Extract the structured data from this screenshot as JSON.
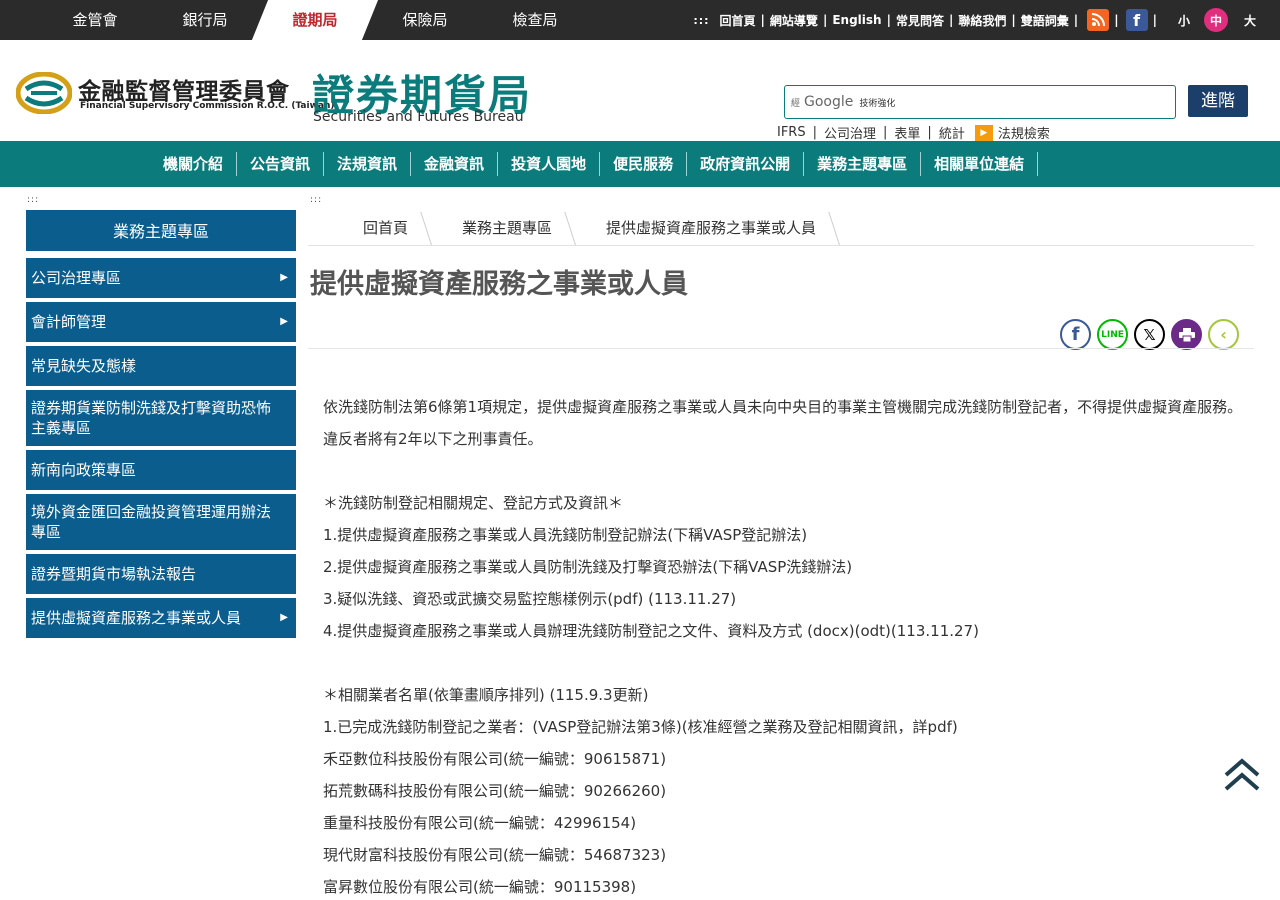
{
  "agency_tabs": [
    {
      "label": "金管會"
    },
    {
      "label": "銀行局"
    },
    {
      "label": "證期局"
    },
    {
      "label": "保險局"
    },
    {
      "label": "檢查局"
    }
  ],
  "util": {
    "dots": ":::",
    "links": [
      "回首頁",
      "網站導覽",
      "English",
      "常見問答",
      "聯絡我們",
      "雙語詞彙"
    ],
    "font_small": "小",
    "font_medium": "中",
    "font_large": "大"
  },
  "header": {
    "fsc_name_zh": "金融監督管理委員會",
    "fsc_name_en": "Financial Supervisory Commission R.O.C. (Taiwan)",
    "bureau_name_zh": "證券期貨局",
    "bureau_name_en": "Securities and Futures Bureau"
  },
  "search": {
    "by": "經",
    "brand": "Google",
    "enhanced": "技術強化",
    "button": "進階"
  },
  "quick_links": [
    "IFRS",
    "公司治理",
    "表單",
    "統計"
  ],
  "law_search": "法規檢索",
  "main_nav": [
    "機關介紹",
    "公告資訊",
    "法規資訊",
    "金融資訊",
    "投資人園地",
    "便民服務",
    "政府資訊公開",
    "業務主題專區",
    "相關單位連結"
  ],
  "sidebar": {
    "dots": ":::",
    "title": "業務主題專區",
    "items": [
      {
        "label": "公司治理專區",
        "caret": "▶"
      },
      {
        "label": "會計師管理",
        "caret": "▶"
      },
      {
        "label": "常見缺失及態樣"
      },
      {
        "label": "證券期貨業防制洗錢及打擊資助恐怖主義專區"
      },
      {
        "label": "新南向政策專區"
      },
      {
        "label": "境外資金匯回金融投資管理運用辦法專區"
      },
      {
        "label": "證券暨期貨市場執法報告"
      },
      {
        "label": "提供虛擬資產服務之事業或人員",
        "caret": "▶"
      }
    ]
  },
  "content": {
    "dots": ":::",
    "breadcrumb": [
      "回首頁",
      "業務主題專區",
      "提供虛擬資產服務之事業或人員"
    ],
    "title": "提供虛擬資產服務之事業或人員",
    "paragraphs": [
      "依洗錢防制法第6條第1項規定，提供虛擬資產服務之事業或人員未向中央目的事業主管機關完成洗錢防制登記者，不得提供虛擬資產服務。違反者將有2年以下之刑事責任。",
      "",
      "＊洗錢防制登記相關規定、登記方式及資訊＊",
      "1.提供虛擬資產服務之事業或人員洗錢防制登記辦法(下稱VASP登記辦法)",
      "2.提供虛擬資產服務之事業或人員防制洗錢及打擊資恐辦法(下稱VASP洗錢辦法)",
      "3.疑似洗錢、資恐或武擴交易監控態樣例示(pdf) (113.11.27)",
      "4.提供虛擬資產服務之事業或人員辦理洗錢防制登記之文件、資料及方式 (docx)(odt)(113.11.27)",
      "",
      "＊相關業者名單(依筆畫順序排列) (115.9.3更新)",
      "1.已完成洗錢防制登記之業者：(VASP登記辦法第3條)(核准經營之業務及登記相關資訊，詳pdf)",
      "禾亞數位科技股份有限公司(統一編號：90615871)",
      "拓荒數碼科技股份有限公司(統一編號：90266260)",
      "重量科技股份有限公司(統一編號：42996154)",
      "現代財富科技股份有限公司(統一編號：54687323)",
      "富昇數位股份有限公司(統一編號：90115398)"
    ]
  },
  "colors": {
    "teal": "#0c7b7c",
    "sidebar_blue": "#0b5d8d",
    "active_tab": "#c0272d",
    "font_size_active": "#e22e7e"
  }
}
